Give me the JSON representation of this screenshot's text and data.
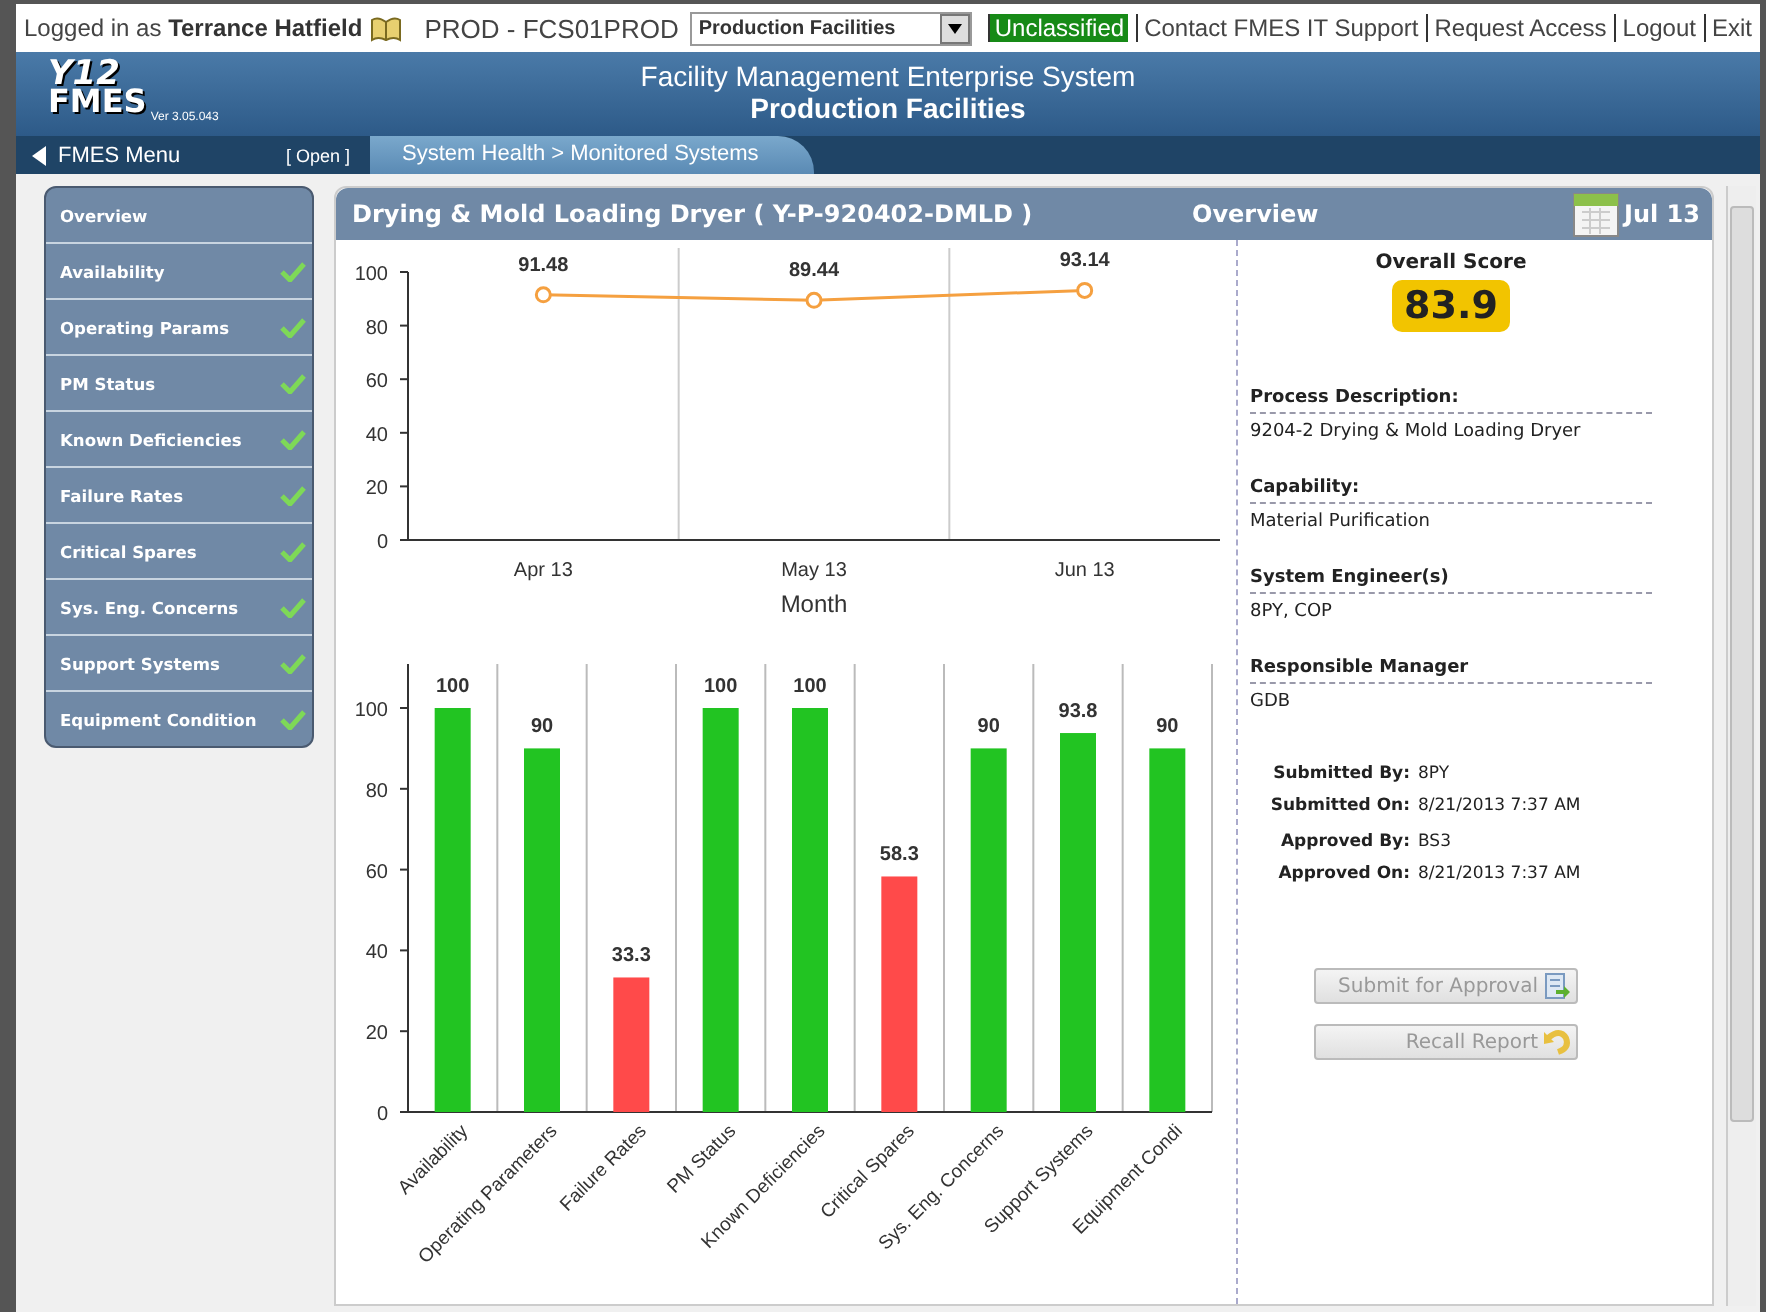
{
  "top_bar": {
    "login_prefix": "Logged in as",
    "user_name": "Terrance Hatfield",
    "environment": "PROD - FCS01PROD",
    "facility_select": {
      "value": "Production Facilities"
    },
    "links": [
      {
        "label": "Unclassified",
        "kind": "badge"
      },
      {
        "label": "Contact FMES IT Support",
        "kind": "link"
      },
      {
        "label": "Request Access",
        "kind": "link"
      },
      {
        "label": "Logout",
        "kind": "link"
      },
      {
        "label": "Exit",
        "kind": "link"
      }
    ]
  },
  "header": {
    "logo_top": "Y12",
    "logo_bottom": "FMES",
    "version": "Ver 3.05.043",
    "title": "Facility Management Enterprise System",
    "subtitle": "Production Facilities"
  },
  "nav": {
    "menu": "FMES Menu",
    "open": "[ Open ]",
    "breadcrumb": "System Health > Monitored Systems"
  },
  "sidebar": {
    "items": [
      {
        "label": "Overview",
        "checked": false
      },
      {
        "label": "Availability",
        "checked": true
      },
      {
        "label": "Operating Params",
        "checked": true
      },
      {
        "label": "PM Status",
        "checked": true
      },
      {
        "label": "Known Deficiencies",
        "checked": true
      },
      {
        "label": "Failure Rates",
        "checked": true
      },
      {
        "label": "Critical Spares",
        "checked": true
      },
      {
        "label": "Sys. Eng. Concerns",
        "checked": true
      },
      {
        "label": "Support Systems",
        "checked": true
      },
      {
        "label": "Equipment Condition",
        "checked": true
      }
    ]
  },
  "panel": {
    "title": "Drying & Mold Loading Dryer ( Y-P-920402-DMLD )",
    "view": "Overview",
    "date": "Jul 13",
    "line_chart": {
      "chart_data": {
        "type": "line",
        "xlabel": "Month",
        "categories": [
          "Apr 13",
          "May 13",
          "Jun 13"
        ],
        "series": [
          {
            "color": "#f5a040",
            "marker": true,
            "values": [
              91.48,
              89.44,
              93.14
            ]
          }
        ],
        "ylim": [
          0,
          100
        ],
        "yticks": [
          0,
          20,
          40,
          60,
          80,
          100
        ],
        "data_labels": true
      }
    },
    "bar_chart": {
      "chart_data": {
        "type": "bar",
        "categories": [
          "Availability",
          "Operating Parameters",
          "Failure Rates",
          "PM Status",
          "Known Deficiencies",
          "Critical Spares",
          "Sys. Eng. Concerns",
          "Support Systems",
          "Equipment Condi"
        ],
        "series": [
          {
            "color": "#22c422",
            "values": [
              100,
              90,
              null,
              100,
              100,
              null,
              90,
              93.8,
              90
            ]
          },
          {
            "color": "#ff4a4a",
            "values": [
              null,
              null,
              33.3,
              null,
              null,
              58.3,
              null,
              null,
              null
            ]
          }
        ],
        "stacked": true,
        "ylim": [
          0,
          100
        ],
        "yticks": [
          0,
          20,
          40,
          60,
          80,
          100
        ],
        "data_labels": true
      }
    },
    "score_label": "Overall Score",
    "score": "83.9",
    "fields": [
      {
        "label": "Process Description:",
        "value": "9204-2 Drying & Mold Loading Dryer"
      },
      {
        "label": "Capability:",
        "value": "Material Purification"
      },
      {
        "label": "System Engineer(s)",
        "value": "8PY, COP"
      },
      {
        "label": "Responsible Manager",
        "value": "GDB"
      }
    ],
    "submission": [
      [
        {
          "label": "Submitted By:",
          "value": "8PY"
        },
        {
          "label": "Submitted On:",
          "value": "8/21/2013 7:37 AM"
        }
      ],
      [
        {
          "label": "Approved By:",
          "value": "BS3"
        },
        {
          "label": "Approved On:",
          "value": "8/21/2013 7:37 AM"
        }
      ]
    ],
    "buttons": [
      {
        "label": "Submit for Approval",
        "kind": "submit",
        "disabled": true
      },
      {
        "label": "Recall Report",
        "kind": "recall",
        "disabled": true
      }
    ]
  }
}
